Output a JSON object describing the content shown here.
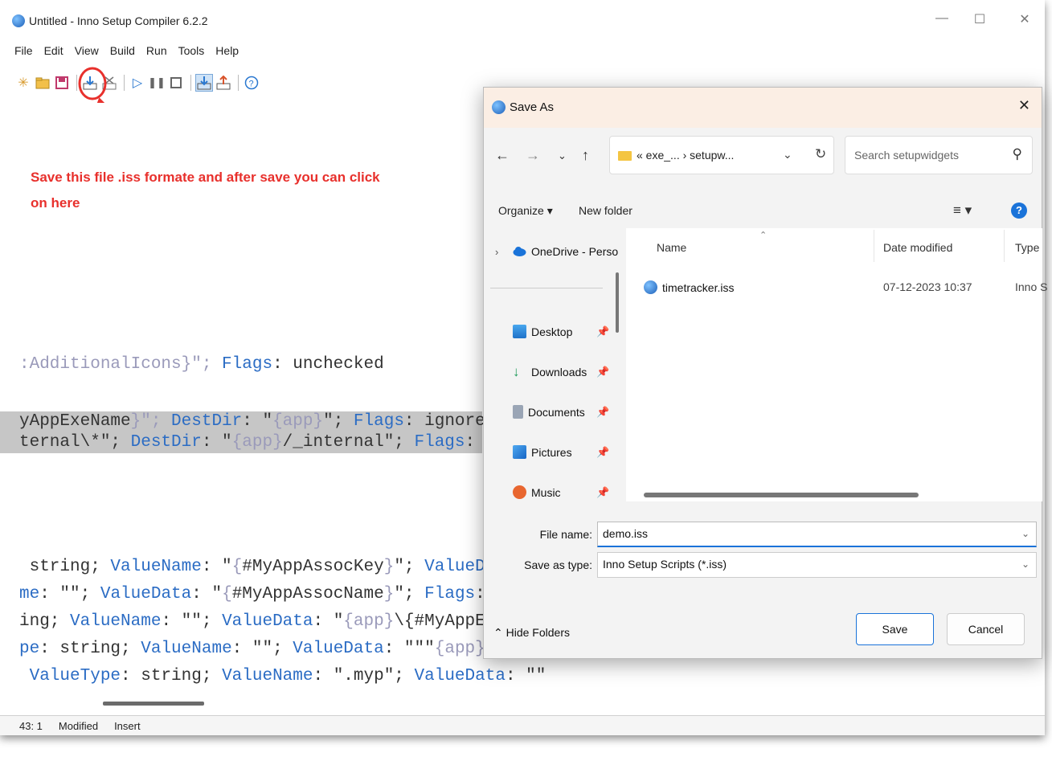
{
  "window": {
    "title": "Untitled - Inno Setup Compiler 6.2.2"
  },
  "menu": [
    "File",
    "Edit",
    "View",
    "Build",
    "Run",
    "Tools",
    "Help"
  ],
  "annotation": "Save this file .iss formate and after save you can click on here",
  "editor_lines": {
    "l1a": ":AdditionalIcons}\"; ",
    "l1k": "Flags",
    "l1b": ": unchecked",
    "l2a": "yAppExeName",
    "l2b": "}\"; ",
    "l2k1": "DestDir",
    "l2c": ": \"",
    "l2d": "{app}",
    "l2e": "\"; ",
    "l2k2": "Flags",
    "l2f": ": ignorever",
    "l3a": "ternal\\*\"; ",
    "l3k1": "DestDir",
    "l3b": ": \"",
    "l3c": "{app}",
    "l3d": "/_internal\"; ",
    "l3k2": "Flags",
    "l3e": ": ign",
    "l4a": " string; ",
    "l4k1": "ValueName",
    "l4b": ": \"",
    "l4c": "{",
    "l4d": "#MyAppAssocKey",
    "l4e": "}",
    "l4f": "\"; ",
    "l4k2": "ValueData",
    "l5k0": "me",
    "l5a": ": \"\"; ",
    "l5k1": "ValueData",
    "l5b": ": \"",
    "l5c": "{",
    "l5d": "#MyAppAssocName",
    "l5e": "}",
    "l5f": "\"; ",
    "l5k2": "Flags",
    "l5g": ": ur",
    "l6a": "ing; ",
    "l6k1": "ValueName",
    "l6b": ": \"\"; ",
    "l6k2": "ValueData",
    "l6c": ": \"",
    "l6d": "{app}",
    "l6e": "\\{",
    "l6f": "#MyAppExeN",
    "l7k0": "pe",
    "l7a": ": string; ",
    "l7k1": "ValueName",
    "l7b": ": \"\"; ",
    "l7k2": "ValueData",
    "l7c": ": \"\"\"",
    "l7d": "{app}",
    "l7e": "\\{#",
    "l8k0": " ValueType",
    "l8a": ": string; ",
    "l8k1": "ValueName",
    "l8b": ": \".myp\"; ",
    "l8k2": "ValueData",
    "l8c": ": \"\""
  },
  "status": {
    "position": "43:  1",
    "modified": "Modified",
    "mode": "Insert"
  },
  "dialog": {
    "title": "Save As",
    "address": "« exe_...  ›  setupw...",
    "search_placeholder": "Search setupwidgets",
    "organize": "Organize ▾",
    "new_folder": "New folder",
    "nav": {
      "onedrive": "OneDrive - Perso",
      "desktop": "Desktop",
      "downloads": "Downloads",
      "documents": "Documents",
      "pictures": "Pictures",
      "music": "Music"
    },
    "columns": {
      "name": "Name",
      "date": "Date modified",
      "type": "Type"
    },
    "file": {
      "name": "timetracker.iss",
      "date": "07-12-2023 10:37",
      "type": "Inno S"
    },
    "file_name_label": "File name:",
    "file_name_value": "demo.iss",
    "save_type_label": "Save as type:",
    "save_type_value": "Inno Setup Scripts (*.iss)",
    "hide_folders": "Hide Folders",
    "save": "Save",
    "cancel": "Cancel"
  },
  "colors": {
    "accent": "#1a73d9",
    "annotation": "#e8302c",
    "keyword": "#2b6cc4"
  }
}
